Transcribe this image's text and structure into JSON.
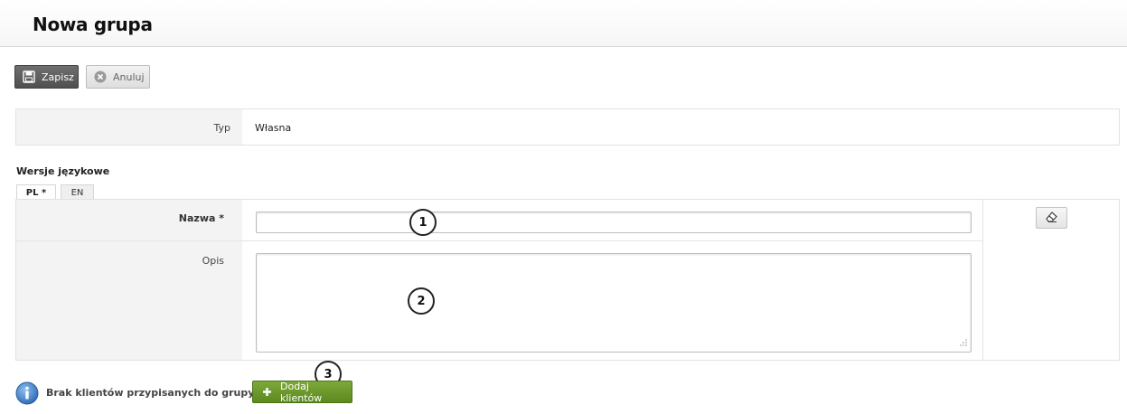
{
  "page": {
    "title": "Nowa grupa"
  },
  "toolbar": {
    "save_label": "Zapisz",
    "cancel_label": "Anuluj"
  },
  "type_row": {
    "label": "Typ",
    "value": "Własna"
  },
  "languages": {
    "section_title": "Wersje językowe",
    "tabs": [
      {
        "label": "PL *",
        "active": true
      },
      {
        "label": "EN",
        "active": false
      }
    ],
    "fields": {
      "name_label": "Nazwa *",
      "name_value": "",
      "description_label": "Opis",
      "description_value": ""
    }
  },
  "callouts": [
    "1",
    "2",
    "3"
  ],
  "clients": {
    "empty_message": "Brak klientów przypisanych do grupy",
    "add_button_label": "Dodaj klientów"
  },
  "icons": {
    "save": "floppy-disk-icon",
    "cancel": "close-circle-icon",
    "eraser": "eraser-icon",
    "info": "info-icon",
    "add": "plus-icon"
  },
  "colors": {
    "save_button": "#5a5a5a",
    "add_button": "#6b9a2a",
    "info_icon": "#3a7cc4"
  }
}
